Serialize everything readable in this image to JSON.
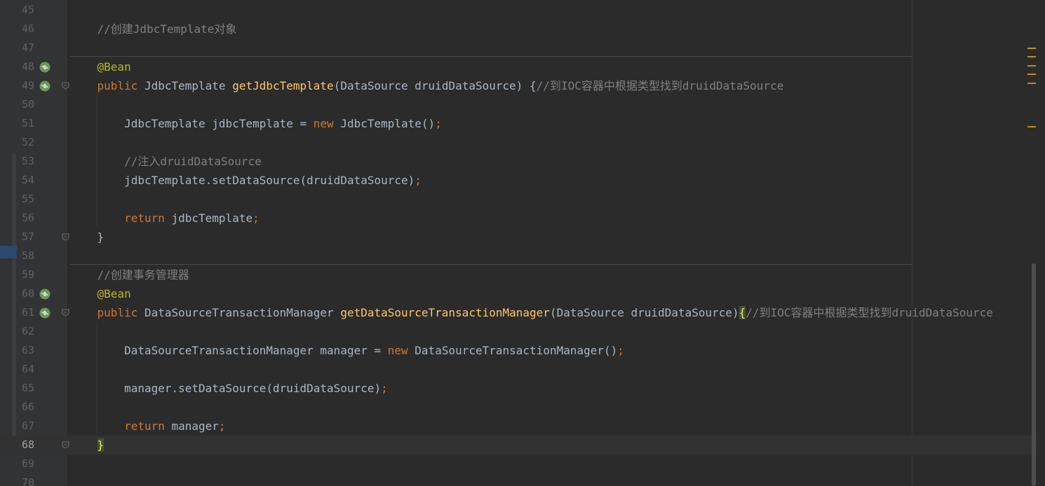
{
  "editor": {
    "lines": [
      {
        "num": "45",
        "tokens": []
      },
      {
        "num": "46",
        "tokens": [
          {
            "t": "    //创建JdbcTemplate对象",
            "c": "cm"
          }
        ]
      },
      {
        "num": "47",
        "tokens": []
      },
      {
        "num": "48",
        "icon": "spring-bean-icon",
        "tokens": [
          {
            "t": "    "
          },
          {
            "t": "@Bean",
            "c": "ann"
          }
        ]
      },
      {
        "num": "49",
        "icon": "spring-bean-icon",
        "fold": true,
        "tokens": [
          {
            "t": "    "
          },
          {
            "t": "public",
            "c": "kw"
          },
          {
            "t": " JdbcTemplate "
          },
          {
            "t": "getJdbcTemplate",
            "c": "fn"
          },
          {
            "t": "(DataSource druidDataSource) {"
          },
          {
            "t": "//到IOC容器中根据类型找到druidDataSource",
            "c": "cm"
          }
        ]
      },
      {
        "num": "50",
        "tokens": []
      },
      {
        "num": "51",
        "tokens": [
          {
            "t": "        JdbcTemplate jdbcTemplate = "
          },
          {
            "t": "new",
            "c": "kw"
          },
          {
            "t": " JdbcTemplate()"
          },
          {
            "t": ";",
            "c": "punct"
          }
        ]
      },
      {
        "num": "52",
        "tokens": []
      },
      {
        "num": "53",
        "tokens": [
          {
            "t": "        //注入druidDataSource",
            "c": "cm"
          }
        ]
      },
      {
        "num": "54",
        "tokens": [
          {
            "t": "        jdbcTemplate.setDataSource(druidDataSource)"
          },
          {
            "t": ";",
            "c": "punct"
          }
        ]
      },
      {
        "num": "55",
        "tokens": []
      },
      {
        "num": "56",
        "tokens": [
          {
            "t": "        "
          },
          {
            "t": "return",
            "c": "kw"
          },
          {
            "t": " jdbcTemplate"
          },
          {
            "t": ";",
            "c": "punct"
          }
        ]
      },
      {
        "num": "57",
        "fold": true,
        "tokens": [
          {
            "t": "    }"
          }
        ]
      },
      {
        "num": "58",
        "tokens": []
      },
      {
        "num": "59",
        "tokens": [
          {
            "t": "    //创建事务管理器",
            "c": "cm"
          }
        ]
      },
      {
        "num": "60",
        "icon": "spring-bean-icon",
        "tokens": [
          {
            "t": "    "
          },
          {
            "t": "@Bean",
            "c": "ann"
          }
        ]
      },
      {
        "num": "61",
        "icon": "spring-bean-icon",
        "fold": true,
        "tokens": [
          {
            "t": "    "
          },
          {
            "t": "public",
            "c": "kw"
          },
          {
            "t": " DataSourceTransactionManager "
          },
          {
            "t": "getDataSourceTransactionManager",
            "c": "fn"
          },
          {
            "t": "(DataSource druidDataSource)"
          },
          {
            "t": "{",
            "c": "brace-hl"
          },
          {
            "t": "//到IOC容器中根据类型找到druidDataSource",
            "c": "cm"
          }
        ]
      },
      {
        "num": "62",
        "tokens": []
      },
      {
        "num": "63",
        "tokens": [
          {
            "t": "        DataSourceTransactionManager manager = "
          },
          {
            "t": "new",
            "c": "kw"
          },
          {
            "t": " DataSourceTransactionManager()"
          },
          {
            "t": ";",
            "c": "punct"
          }
        ]
      },
      {
        "num": "64",
        "tokens": []
      },
      {
        "num": "65",
        "tokens": [
          {
            "t": "        manager.setDataSource(druidDataSource)"
          },
          {
            "t": ";",
            "c": "punct"
          }
        ]
      },
      {
        "num": "66",
        "tokens": []
      },
      {
        "num": "67",
        "tokens": [
          {
            "t": "        "
          },
          {
            "t": "return",
            "c": "kw"
          },
          {
            "t": " manager"
          },
          {
            "t": ";",
            "c": "punct"
          }
        ]
      },
      {
        "num": "68",
        "current": true,
        "fold": true,
        "tokens": [
          {
            "t": "    "
          },
          {
            "t": "}",
            "c": "brace-hl"
          }
        ]
      },
      {
        "num": "69",
        "tokens": []
      },
      {
        "num": "70",
        "tokens": []
      }
    ]
  },
  "colors": {
    "background": "#2b2b2b",
    "gutter": "#313335",
    "keyword": "#cc7832",
    "annotation": "#bbb529",
    "method": "#ffc66d",
    "comment": "#808080",
    "text": "#a9b7c6",
    "spring_icon": "#6a9955",
    "marker": "#be9117"
  },
  "scrollbar": {
    "marker_count": 5
  }
}
